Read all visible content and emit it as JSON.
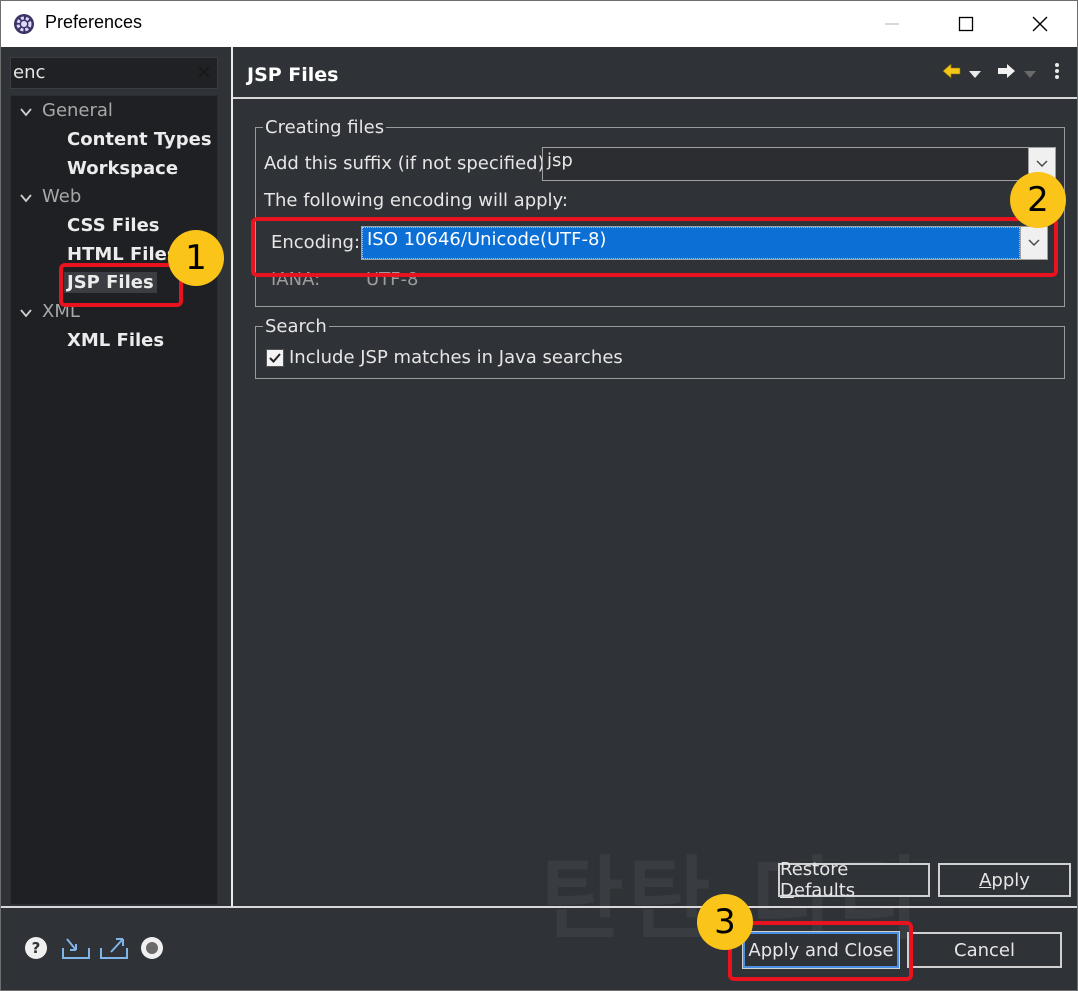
{
  "window": {
    "title": "Preferences"
  },
  "filter": {
    "value": "enc"
  },
  "tree": {
    "general": {
      "label": "General",
      "children": [
        "Content Types",
        "Workspace"
      ]
    },
    "web": {
      "label": "Web",
      "children": [
        "CSS Files",
        "HTML Files",
        "JSP Files"
      ]
    },
    "xml": {
      "label": "XML",
      "children": [
        "XML Files"
      ]
    },
    "selected": "JSP Files"
  },
  "page": {
    "title": "JSP Files"
  },
  "creating_files": {
    "legend": "Creating files",
    "suffix_label": "Add this suffix (if not specified):",
    "suffix_value": "jsp",
    "encoding_hint": "The following encoding will apply:",
    "encoding_label": "Encoding:",
    "encoding_value": "ISO 10646/Unicode(UTF-8)",
    "iana_label": "IANA:",
    "iana_value": "UTF-8"
  },
  "search": {
    "legend": "Search",
    "checkbox_label": "Include JSP matches in Java searches",
    "checked": true
  },
  "buttons": {
    "restore_defaults": {
      "pre": "Restore ",
      "mnemonic": "D",
      "post": "efaults"
    },
    "apply": {
      "pre": "",
      "mnemonic": "A",
      "post": "pply"
    },
    "apply_and_close": "Apply and Close",
    "cancel": "Cancel"
  },
  "annotations": {
    "badge1": "1",
    "badge2": "2",
    "badge3": "3",
    "highlight_color": "#e8131e",
    "badge_color": "#fbc418"
  },
  "watermark": "탄탄 디디",
  "icons": {
    "app": "eclipse-preferences-icon",
    "footer": [
      "help-icon",
      "import-icon",
      "export-icon",
      "record-icon"
    ],
    "nav": [
      "back-arrow-icon",
      "back-dropdown-icon",
      "forward-arrow-icon",
      "forward-dropdown-icon",
      "view-menu-icon"
    ]
  }
}
